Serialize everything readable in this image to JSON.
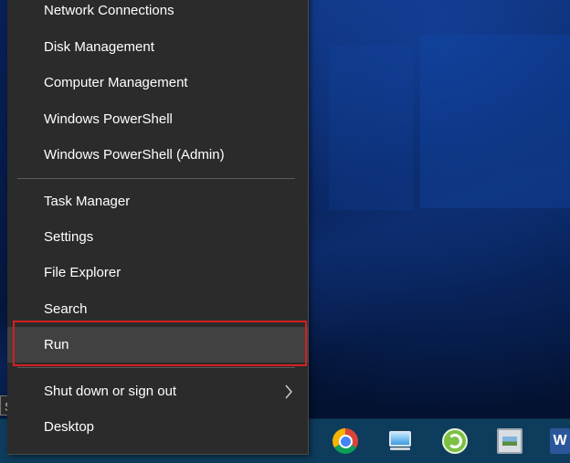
{
  "menu": {
    "group1": [
      {
        "label": "Network Connections",
        "name": "menu-item-network-connections"
      },
      {
        "label": "Disk Management",
        "name": "menu-item-disk-management"
      },
      {
        "label": "Computer Management",
        "name": "menu-item-computer-management"
      },
      {
        "label": "Windows PowerShell",
        "name": "menu-item-windows-powershell"
      },
      {
        "label": "Windows PowerShell (Admin)",
        "name": "menu-item-windows-powershell-admin"
      }
    ],
    "group2": [
      {
        "label": "Task Manager",
        "name": "menu-item-task-manager"
      },
      {
        "label": "Settings",
        "name": "menu-item-settings"
      },
      {
        "label": "File Explorer",
        "name": "menu-item-file-explorer"
      },
      {
        "label": "Search",
        "name": "menu-item-search"
      },
      {
        "label": "Run",
        "name": "menu-item-run"
      }
    ],
    "group3": [
      {
        "label": "Shut down or sign out",
        "name": "menu-item-shut-down",
        "has_submenu": true
      },
      {
        "label": "Desktop",
        "name": "menu-item-desktop"
      }
    ],
    "highlighted_item": "Run"
  },
  "tooltip": {
    "start": "Start"
  },
  "taskbar": {
    "icons": [
      "chrome-icon",
      "this-pc-icon",
      "green-app-icon",
      "photos-icon",
      "word-icon"
    ],
    "word_letter": "W"
  },
  "colors": {
    "menu_bg": "#2b2b2b",
    "hover_bg": "#414141",
    "highlight_border": "#d42020",
    "taskbar_bg": "#0e3c5c"
  }
}
